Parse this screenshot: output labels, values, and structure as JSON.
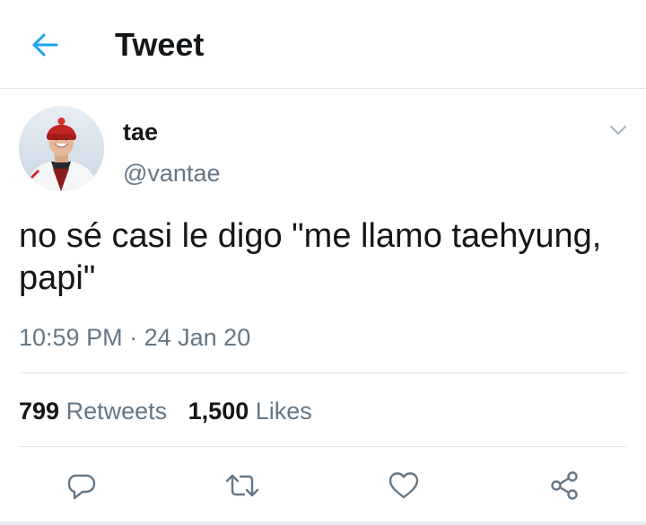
{
  "header": {
    "title": "Tweet",
    "back_icon": "arrow-left-icon",
    "accent_color": "#1da1f2"
  },
  "author": {
    "display_name": "tae",
    "handle": "@vantae",
    "avatar_icon": "avatar-photo"
  },
  "tweet": {
    "text": "no sé casi le digo \"me llamo taehyung, papi\"",
    "time": "10:59 PM",
    "separator": "·",
    "date": "24 Jan 20"
  },
  "stats": {
    "retweets_count": "799",
    "retweets_label": "Retweets",
    "likes_count": "1,500",
    "likes_label": "Likes"
  },
  "actions": {
    "icons": [
      "reply-icon",
      "retweet-icon",
      "like-icon",
      "share-icon"
    ]
  },
  "colors": {
    "text": "#14171a",
    "secondary": "#657786",
    "divider": "#e1e8ed"
  }
}
